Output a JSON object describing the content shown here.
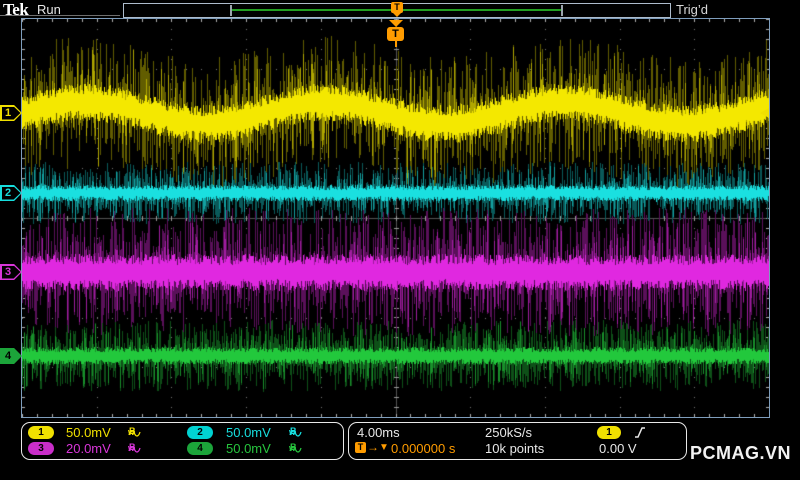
{
  "header": {
    "logo": "Tek",
    "acq_state": "Run",
    "trig_status": "Trig’d"
  },
  "channels": [
    {
      "num": "1",
      "scale": "50.0mV",
      "color": "#f0e000"
    },
    {
      "num": "2",
      "scale": "50.0mV",
      "color": "#17dede"
    },
    {
      "num": "3",
      "scale": "20.0mV",
      "color": "#d936d9"
    },
    {
      "num": "4",
      "scale": "50.0mV",
      "color": "#27c53e"
    }
  ],
  "readout_icons": {
    "coupling": "sine-wave",
    "bw_main": "B",
    "bw_sub": "W"
  },
  "horizontal": {
    "time_per_div": "4.00ms",
    "sample_rate": "250kS/s",
    "record_length": "10k points"
  },
  "trigger": {
    "marker": "T",
    "arrow": "→",
    "indicator": "▼",
    "position": "0.000000 s",
    "source": "1",
    "slope_icon": "rising-edge",
    "level": "0.00 V"
  },
  "watermark": "PCMAG.VN",
  "ui_colors": {
    "trigger_orange": "#ff9c00",
    "graticule_border": "#7e9dbc",
    "grid_dots": "#787878",
    "status_text": "#e8e8e8"
  },
  "chart_data": {
    "type": "line",
    "title": "Tektronix oscilloscope display: 4 noisy channel traces, triggered, Run mode",
    "x_axis": {
      "divisions": 10,
      "seconds_per_div": 0.004,
      "total_time_s": 0.04,
      "grid": true
    },
    "y_axis": {
      "divisions": 8,
      "grid": true
    },
    "legend_position": "bottom",
    "trigger": {
      "position_s": 0.0,
      "level_v": 0.0,
      "source_channel": 1,
      "slope": "rising",
      "screen_x_fraction": 0.5
    },
    "series": [
      {
        "name": "CH1",
        "color": "#f4e800",
        "volts_per_div_mV": 50.0,
        "offset_div": 2.11,
        "noise_core_div": 0.28,
        "noise_peak_div": 0.75,
        "modulation": {
          "shape": "sine",
          "amplitude_div": 0.22,
          "period_fraction_of_screen": 0.32,
          "peak_x_fraction": 0.085
        }
      },
      {
        "name": "CH2",
        "color": "#1ae0e0",
        "volts_per_div_mV": 50.0,
        "offset_div": 0.5,
        "noise_core_div": 0.12,
        "noise_peak_div": 0.35,
        "modulation": null
      },
      {
        "name": "CH3",
        "color": "#e028e0",
        "volts_per_div_mV": 20.0,
        "offset_div": -1.09,
        "noise_core_div": 0.27,
        "noise_peak_div": 0.72,
        "modulation": null
      },
      {
        "name": "CH4",
        "color": "#22c83c",
        "volts_per_div_mV": 50.0,
        "offset_div": -2.77,
        "noise_core_div": 0.13,
        "noise_peak_div": 0.4,
        "modulation": null
      }
    ]
  }
}
